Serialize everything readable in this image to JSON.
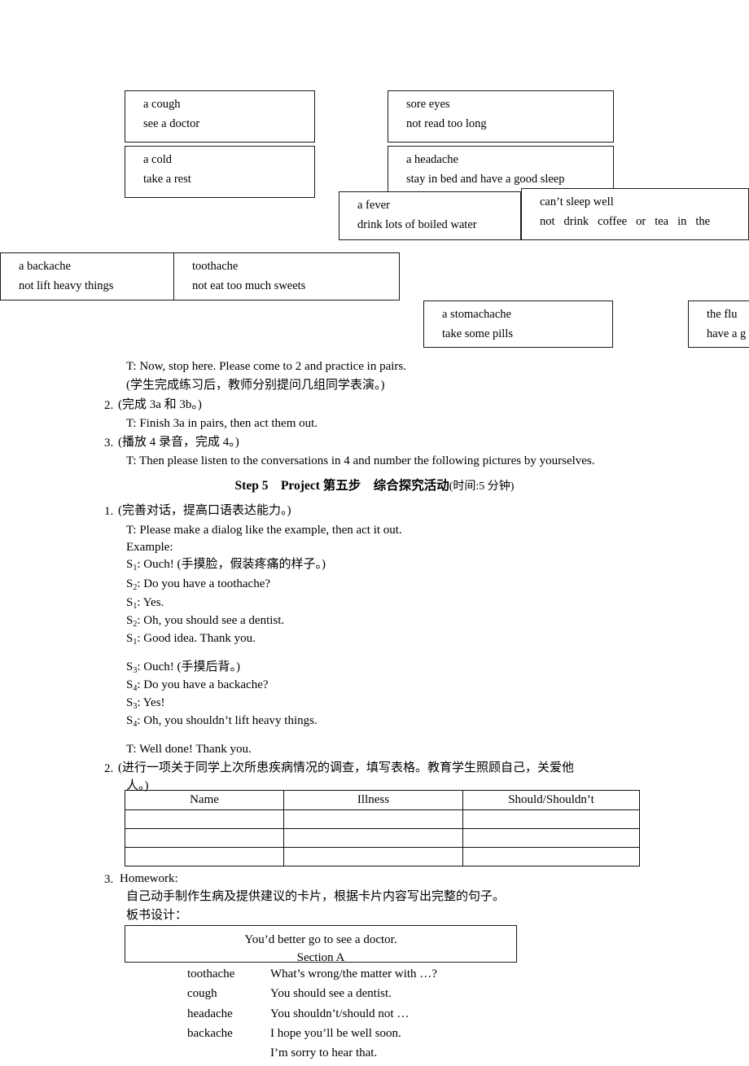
{
  "flashcards": [
    {
      "id": "cough",
      "ailment": "a cough",
      "advice": "see a doctor"
    },
    {
      "id": "cold",
      "ailment": "a cold",
      "advice": "take a rest"
    },
    {
      "id": "sore-eyes",
      "ailment": "sore eyes",
      "advice": "not read too long"
    },
    {
      "id": "headache",
      "ailment": "a headache",
      "advice": "stay in bed and have a good sleep"
    },
    {
      "id": "fever",
      "ailment": "a fever",
      "advice": "drink lots of boiled water"
    },
    {
      "id": "cant-sleep",
      "ailment": "can’t sleep well",
      "advice_words": [
        "not",
        "drink",
        "coffee",
        "or",
        "tea",
        "in",
        "the"
      ]
    },
    {
      "id": "backache",
      "ailment": "a backache",
      "advice": "not lift heavy things"
    },
    {
      "id": "toothache",
      "ailment": "toothache",
      "advice": "not eat too much sweets"
    },
    {
      "id": "stomachache",
      "ailment": "a stomachache",
      "advice": "take some pills"
    },
    {
      "id": "flu",
      "ailment": "the flu",
      "advice": "have a g"
    }
  ],
  "lesson": {
    "line_teacher_stop": "T: Now, stop here. Please come to 2 and practice in pairs.",
    "line_cn_after_practice": "(学生完成练习后，教师分别提问几组同学表演。)",
    "item2_num": "2.",
    "item2_cn": "(完成 3a 和 3b。)",
    "item2_teacher": "T: Finish 3a in pairs, then act them out.",
    "item3_num": "3.",
    "item3_cn": "(播放 4 录音，完成 4。)",
    "item3_teacher": "T: Then please listen to the conversations in 4 and number the following pictures by yourselves."
  },
  "step5": {
    "bold": "Step 5 Project 第五步　综合探究活动",
    "time": "(时间:5 分钟)"
  },
  "project": {
    "item1_num": "1.",
    "item1_cn": "(完善对话，提高口语表达能力。)",
    "item1_teacher": "T: Please make a dialog like the example, then act it out.",
    "example_label": "Example:",
    "dialog_a": [
      {
        "speaker": "S",
        "sub": "1",
        "text": ": Ouch! (手摸脸，假装疼痛的样子。)"
      },
      {
        "speaker": "S",
        "sub": "2",
        "text": ": Do you have a toothache?"
      },
      {
        "speaker": "S",
        "sub": "1",
        "text": ": Yes."
      },
      {
        "speaker": "S",
        "sub": "2",
        "text": ": Oh, you should see a dentist."
      },
      {
        "speaker": "S",
        "sub": "1",
        "text": ": Good idea. Thank you."
      }
    ],
    "dialog_b": [
      {
        "speaker": "S",
        "sub": "3",
        "text": ": Ouch! (手摸后背。)"
      },
      {
        "speaker": "S",
        "sub": "4",
        "text": ": Do you have a backache?"
      },
      {
        "speaker": "S",
        "sub": "3",
        "text": ": Yes!"
      },
      {
        "speaker": "S",
        "sub": "4",
        "text": ": Oh, you shouldn’t lift heavy things."
      }
    ],
    "teacher_well_done": "T: Well done! Thank you.",
    "item2_num": "2.",
    "item2_cn_line1": "(进行一项关于同学上次所患疾病情况的调查，填写表格。教育学生照顾自己，关爱他",
    "item2_cn_line2": "人。)",
    "item3_num": "3.",
    "item3_label": "Homework:",
    "item3_cn_line1": "自己动手制作生病及提供建议的卡片，根据卡片内容写出完整的句子。",
    "item3_cn_line2": "板书设计："
  },
  "survey_table": {
    "headers": [
      "Name",
      "Illness",
      "Should/Shouldn’t"
    ],
    "rows": [
      [
        "",
        "",
        ""
      ],
      [
        "",
        "",
        ""
      ],
      [
        "",
        "",
        ""
      ]
    ]
  },
  "blackboard": {
    "title": "You’d better go to see a doctor.",
    "section": "Section A",
    "pairs": [
      {
        "term": "toothache",
        "phrase": "What’s wrong/the matter with …?"
      },
      {
        "term": "cough",
        "phrase": "You should see a dentist."
      },
      {
        "term": "headache",
        "phrase": "You shouldn’t/should not …"
      },
      {
        "term": "backache",
        "phrase": "I hope you’ll be well soon."
      },
      {
        "term": "",
        "phrase": "I’m sorry to hear that."
      }
    ]
  }
}
